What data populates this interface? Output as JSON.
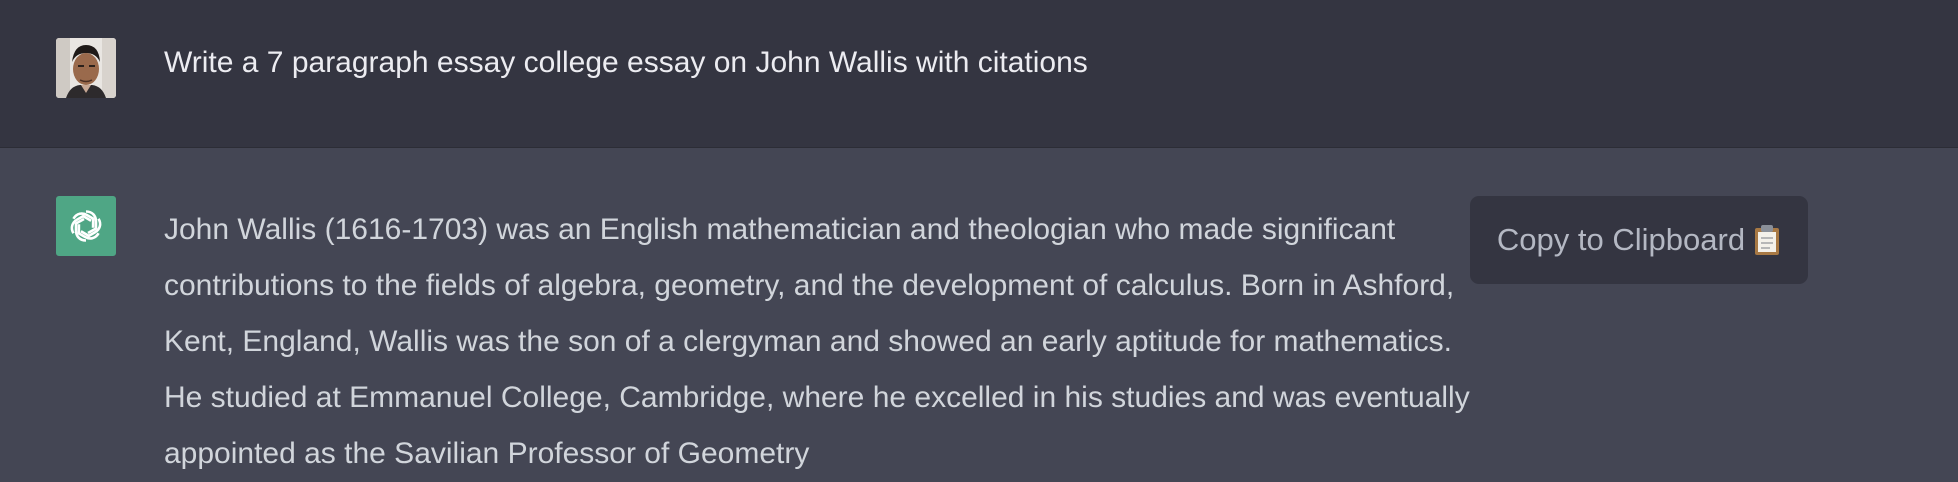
{
  "user_message": {
    "avatar": "user-avatar-photo",
    "text": "Write a 7 paragraph essay college essay on John Wallis with citations"
  },
  "assistant_message": {
    "avatar": "openai-logo-icon",
    "paragraph": "John Wallis (1616-1703) was an English mathematician and theologian who made significant contributions to the fields of algebra, geometry, and the development of calculus. Born in Ashford, Kent, England, Wallis was the son of a clergyman and showed an early aptitude for mathematics. He studied at Emmanuel College, Cambridge, where he excelled in his studies and was eventually appointed as the Savilian Professor of Geometry",
    "copy_button_label": "Copy to Clipboard",
    "copy_button_icon": "clipboard-icon"
  },
  "colors": {
    "user_bg": "#343541",
    "assistant_bg": "#444654",
    "bot_avatar_bg": "#4fa685",
    "text_primary": "#ececf1",
    "text_secondary": "#d1d5db"
  }
}
